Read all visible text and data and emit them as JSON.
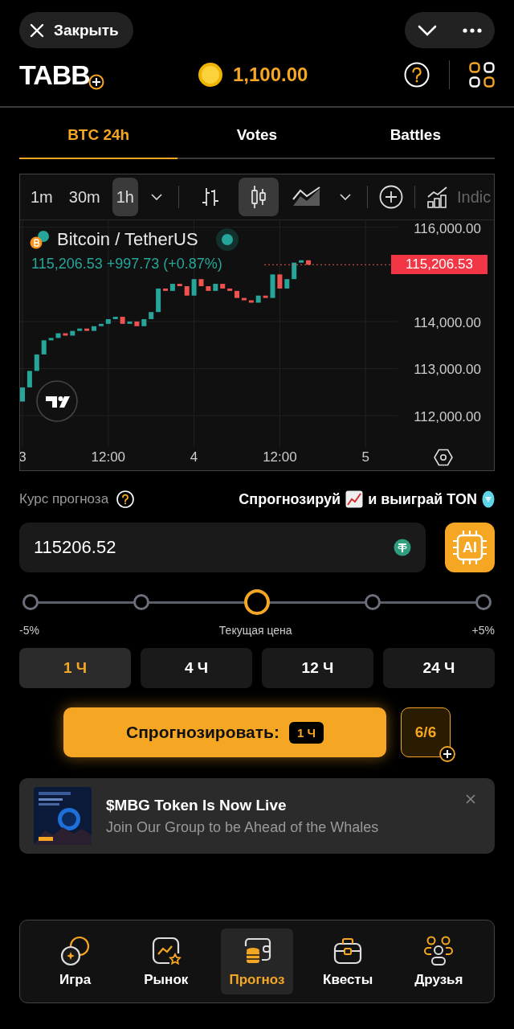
{
  "top_bar": {
    "close_label": "Закрыть"
  },
  "header": {
    "logo": "TABB",
    "balance": "1,100.00"
  },
  "tabs": [
    {
      "label": "BTC 24h",
      "selected": true
    },
    {
      "label": "Votes",
      "selected": false
    },
    {
      "label": "Battles",
      "selected": false
    }
  ],
  "chart": {
    "intervals": [
      {
        "label": "1m",
        "selected": false
      },
      {
        "label": "30m",
        "selected": false
      },
      {
        "label": "1h",
        "selected": true
      }
    ],
    "styles": [
      {
        "kind": "bars",
        "selected": false
      },
      {
        "kind": "candles",
        "selected": true
      },
      {
        "kind": "area",
        "selected": false
      }
    ],
    "indicators_label": "Indic",
    "symbol": "Bitcoin / TetherUS",
    "quote": "115,206.53 +997.73 (+0.87%)",
    "price_tag": "115,206.53",
    "y_axis_labels": [
      "116,000.00",
      "114,000.00",
      "113,000.00",
      "112,000.00"
    ],
    "x_axis_labels": [
      "3",
      "12:00",
      "4",
      "12:00",
      "5"
    ]
  },
  "forecast": {
    "label": "Курс прогноза",
    "promo_before": "Спрогнозируй",
    "promo_after": "и выиграй TON",
    "value": "115206.52",
    "ai_label": "AI",
    "stops": [
      {
        "selected": false
      },
      {
        "selected": false
      },
      {
        "selected": true
      },
      {
        "selected": false
      },
      {
        "selected": false
      }
    ],
    "range_min": "-5%",
    "range_mid": "Текущая цена",
    "range_max": "+5%",
    "durations": [
      {
        "label": "1 Ч",
        "selected": true
      },
      {
        "label": "4 Ч",
        "selected": false
      },
      {
        "label": "12 Ч",
        "selected": false
      },
      {
        "label": "24 Ч",
        "selected": false
      }
    ],
    "submit_label": "Спрогнозировать:",
    "submit_badge": "1 Ч",
    "attempts": "6/6"
  },
  "ad": {
    "title": "$MBG Token Is Now Live",
    "subtitle": "Join Our Group to be Ahead of the Whales"
  },
  "nav": [
    {
      "label": "Игра",
      "kind": "game",
      "selected": false
    },
    {
      "label": "Рынок",
      "kind": "market",
      "selected": false
    },
    {
      "label": "Прогноз",
      "kind": "forecast",
      "selected": true
    },
    {
      "label": "Квесты",
      "kind": "quests",
      "selected": false
    },
    {
      "label": "Друзья",
      "kind": "friends",
      "selected": false
    }
  ]
}
